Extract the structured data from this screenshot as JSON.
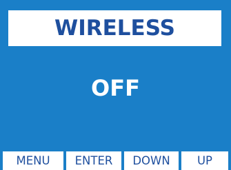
{
  "title": "WIRELESS",
  "status": "OFF",
  "softkeys": {
    "menu": "MENU",
    "enter": "ENTER",
    "down": "DOWN",
    "up": "UP"
  },
  "colors": {
    "background": "#1a7fc8",
    "title_text": "#1e4f9e",
    "status_text": "#ffffff",
    "key_background": "#ffffff"
  }
}
